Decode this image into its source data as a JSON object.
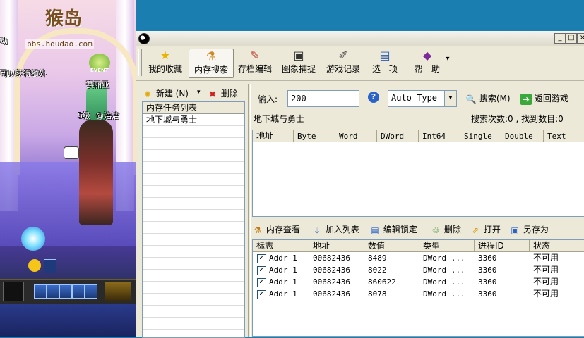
{
  "game": {
    "logo_text": "猴岛",
    "logo_url": "bbs.houdao.com",
    "left_text_1": "动",
    "left_text_2": "可以获得额外",
    "event_label": "EVENT",
    "npc_name": "赛丽亚",
    "player_level": "5级",
    "player_name": "@浩洁"
  },
  "window": {
    "minimize": "_",
    "maximize": "□",
    "close": "×"
  },
  "toolbar": {
    "items": [
      {
        "label": "我的收藏",
        "icon": "star-icon"
      },
      {
        "label": "内存搜索",
        "icon": "memory-search-icon"
      },
      {
        "label": "存档编辑",
        "icon": "save-edit-icon"
      },
      {
        "label": "图象捕捉",
        "icon": "camera-icon"
      },
      {
        "label": "游戏记录",
        "icon": "record-icon"
      },
      {
        "label": "选　项",
        "icon": "options-icon"
      },
      {
        "label": "帮　助",
        "icon": "help-book-icon"
      }
    ],
    "overflow_arrow": "▾"
  },
  "left_panel": {
    "new_label": "新建 (N)",
    "new_dropdown": "▾",
    "delete_label": "删除",
    "list_header": "内存任务列表",
    "tasks": [
      "地下城与勇士"
    ]
  },
  "search": {
    "input_label": "输入:",
    "input_value": "200",
    "type_value": "Auto Type",
    "search_button": "搜索(M)",
    "return_button": "返回游戏",
    "process_name": "地下城与勇士",
    "status_text": "搜索次数:0 , 找到数目:0"
  },
  "results": {
    "columns": [
      "地址",
      "Byte",
      "Word",
      "DWord",
      "Int64",
      "Single",
      "Double",
      "Text"
    ]
  },
  "actions": {
    "memory_view": "内存查看",
    "add_list": "加入列表",
    "edit_lock": "编辑锁定",
    "delete": "删除",
    "open": "打开",
    "save_as": "另存为"
  },
  "locked": {
    "columns": [
      "标志",
      "地址",
      "数值",
      "类型",
      "进程ID",
      "状态"
    ],
    "rows": [
      {
        "flag": "Addr 1",
        "address": "00682436",
        "value": "8489",
        "type": "DWord ...",
        "pid": "3360",
        "status": "不可用",
        "checked": "✓"
      },
      {
        "flag": "Addr 1",
        "address": "00682436",
        "value": "8022",
        "type": "DWord ...",
        "pid": "3360",
        "status": "不可用",
        "checked": "✓"
      },
      {
        "flag": "Addr 1",
        "address": "00682436",
        "value": "860622",
        "type": "DWord ...",
        "pid": "3360",
        "status": "不可用",
        "checked": "✓"
      },
      {
        "flag": "Addr 1",
        "address": "00682436",
        "value": "8078",
        "type": "DWord ...",
        "pid": "3360",
        "status": "不可用",
        "checked": "✓"
      }
    ]
  }
}
